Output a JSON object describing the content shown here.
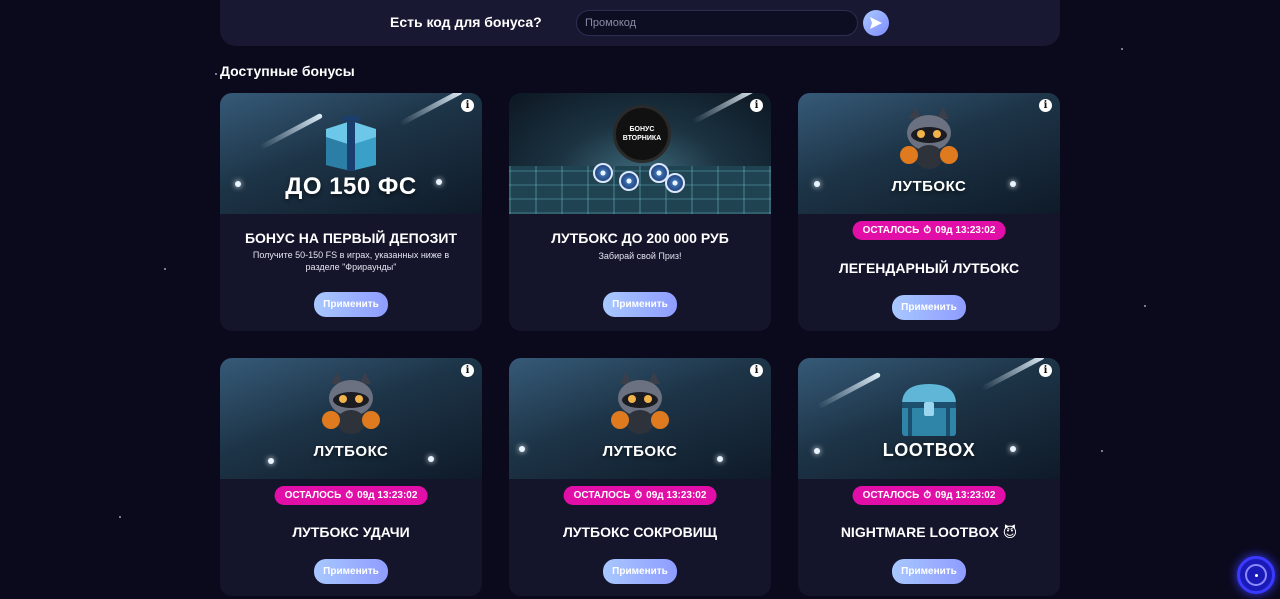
{
  "promo": {
    "question": "Есть код для бонуса?",
    "placeholder": "Промокод"
  },
  "section_title": "Доступные бонусы",
  "cards": [
    {
      "banner_text": "ДО 150 ФС",
      "title": "БОНУС НА ПЕРВЫЙ ДЕПОЗИТ",
      "description": "Получите 50-150 FS в играх, указанных ниже в разделе \"Фрираунды\"",
      "button": "Применить",
      "art": "gift-box"
    },
    {
      "banner_text": "БОНУС ВТОРНИКА",
      "title": "ЛУТБОКС ДО 200 000 РУБ",
      "description": "Забирай свой Приз!",
      "button": "Применить",
      "art": "casino-chips"
    },
    {
      "banner_text": "ЛУТБОКС",
      "timer_label": "ОСТАЛОСЬ",
      "timer_value": "09д 13:23:02",
      "title": "ЛЕГЕНДАРНЫЙ ЛУТБОКС",
      "button": "Применить",
      "art": "raccoon"
    },
    {
      "banner_text": "ЛУТБОКС",
      "timer_label": "ОСТАЛОСЬ",
      "timer_value": "09д 13:23:02",
      "title": "ЛУТБОКС УДАЧИ",
      "button": "Применить",
      "art": "raccoon"
    },
    {
      "banner_text": "ЛУТБОКС",
      "timer_label": "ОСТАЛОСЬ",
      "timer_value": "09д 13:23:02",
      "title": "ЛУТБОКС СОКРОВИЩ",
      "button": "Применить",
      "art": "raccoon"
    },
    {
      "banner_text": "LOOTBOX",
      "timer_label": "ОСТАЛОСЬ",
      "timer_value": "09д 13:23:02",
      "title": "NIGHTMARE LOOTBOX 😈",
      "button": "Применить",
      "art": "chest"
    }
  ],
  "colors": {
    "background": "#0b0a1d",
    "card": "#14142a",
    "timer_badge": "#e20ea8",
    "button_start": "#a8c8ff",
    "button_end": "#8f9cff"
  },
  "icons": [
    "send-icon",
    "info-icon",
    "timer-icon",
    "help-icon"
  ]
}
